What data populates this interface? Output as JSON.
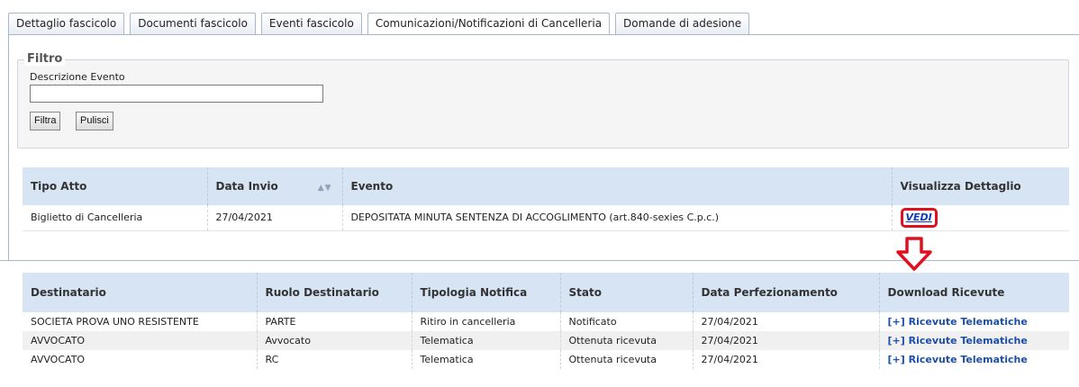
{
  "tabs": [
    {
      "label": "Dettaglio fascicolo"
    },
    {
      "label": "Documenti fascicolo"
    },
    {
      "label": "Eventi fascicolo"
    },
    {
      "label": "Comunicazioni/Notificazioni di Cancelleria"
    },
    {
      "label": "Domande di adesione"
    }
  ],
  "filter": {
    "legend": "Filtro",
    "field_label": "Descrizione Evento",
    "field_value": "",
    "filter_button": "Filtra",
    "clear_button": "Pulisci"
  },
  "events_table": {
    "headers": [
      "Tipo Atto",
      "Data Invio",
      "Evento",
      "Visualizza Dettaglio"
    ],
    "rows": [
      {
        "tipo_atto": "Biglietto di Cancelleria",
        "data_invio": "27/04/2021",
        "evento": "DEPOSITATA MINUTA SENTENZA DI ACCOGLIMENTO (art.840-sexies C.p.c.)",
        "link": "VEDI"
      }
    ]
  },
  "recipients_table": {
    "headers": [
      "Destinatario",
      "Ruolo Destinatario",
      "Tipologia Notifica",
      "Stato",
      "Data Perfezionamento",
      "Download Ricevute"
    ],
    "rows": [
      {
        "destinatario": "SOCIETA PROVA UNO RESISTENTE",
        "ruolo": "PARTE",
        "tipologia": "Ritiro in cancelleria",
        "stato": "Notificato",
        "data": "27/04/2021",
        "ricevute": "[+] Ricevute Telematiche"
      },
      {
        "destinatario": "AVVOCATO",
        "ruolo": "Avvocato",
        "tipologia": "Telematica",
        "stato": "Ottenuta ricevuta",
        "data": "27/04/2021",
        "ricevute": "[+] Ricevute Telematiche"
      },
      {
        "destinatario": "AVVOCATO",
        "ruolo": "RC",
        "tipologia": "Telematica",
        "stato": "Ottenuta ricevuta",
        "data": "27/04/2021",
        "ricevute": "[+] Ricevute Telematiche"
      }
    ]
  },
  "icons": {
    "sort": "sort-arrows-icon",
    "callout": "red-down-arrow-icon"
  },
  "colors": {
    "header_bg": "#d6e4f3",
    "link": "#1c4fa8",
    "highlight": "#e01020"
  }
}
